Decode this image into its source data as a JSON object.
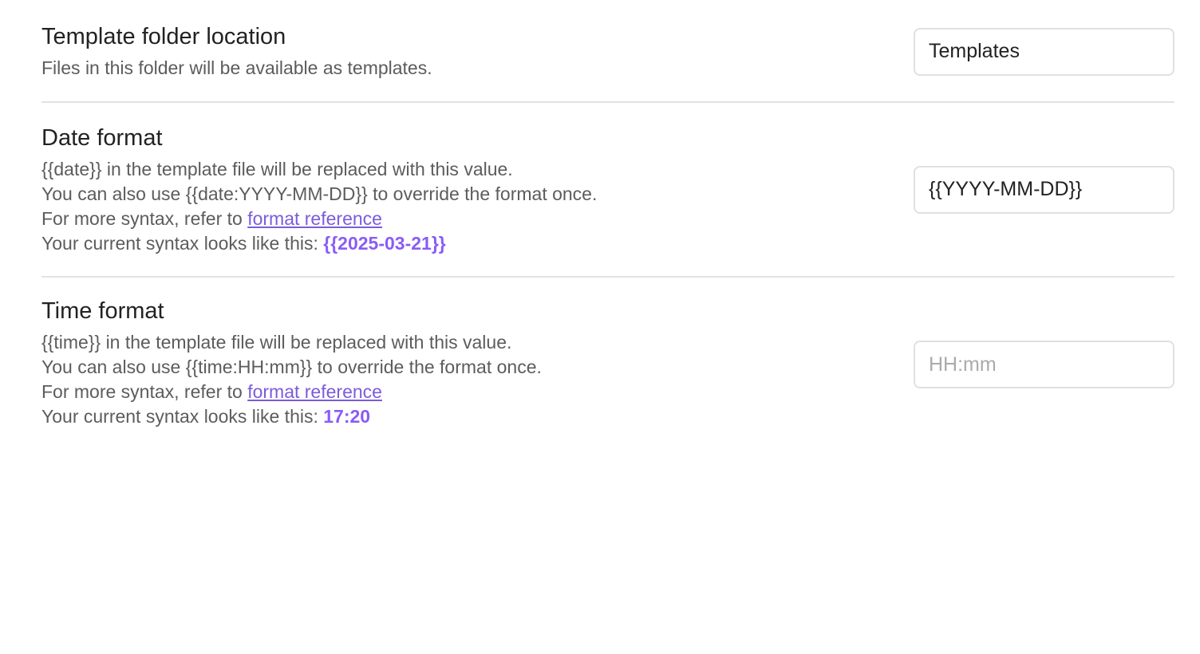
{
  "settings": {
    "folder": {
      "name": "Template folder location",
      "desc": "Files in this folder will be available as templates.",
      "value": "Templates",
      "placeholder": ""
    },
    "date": {
      "name": "Date format",
      "desc_line1": "{{date}} in the template file will be replaced with this value.",
      "desc_line2": "You can also use {{date:YYYY-MM-DD}} to override the format once.",
      "desc_line3_prefix": "For more syntax, refer to ",
      "link_text": "format reference",
      "desc_line4_prefix": "Your current syntax looks like this: ",
      "preview": "{{2025-03-21}}",
      "value": "{{YYYY-MM-DD}}",
      "placeholder": ""
    },
    "time": {
      "name": "Time format",
      "desc_line1": "{{time}} in the template file will be replaced with this value.",
      "desc_line2": "You can also use {{time:HH:mm}} to override the format once.",
      "desc_line3_prefix": "For more syntax, refer to ",
      "link_text": "format reference",
      "desc_line4_prefix": "Your current syntax looks like this: ",
      "preview": "17:20",
      "value": "",
      "placeholder": "HH:mm"
    }
  },
  "colors": {
    "accent": "#8a5cf5",
    "link": "#7b5cdb",
    "divider": "#e2e2e2",
    "muted_text": "#5c5c5c"
  }
}
